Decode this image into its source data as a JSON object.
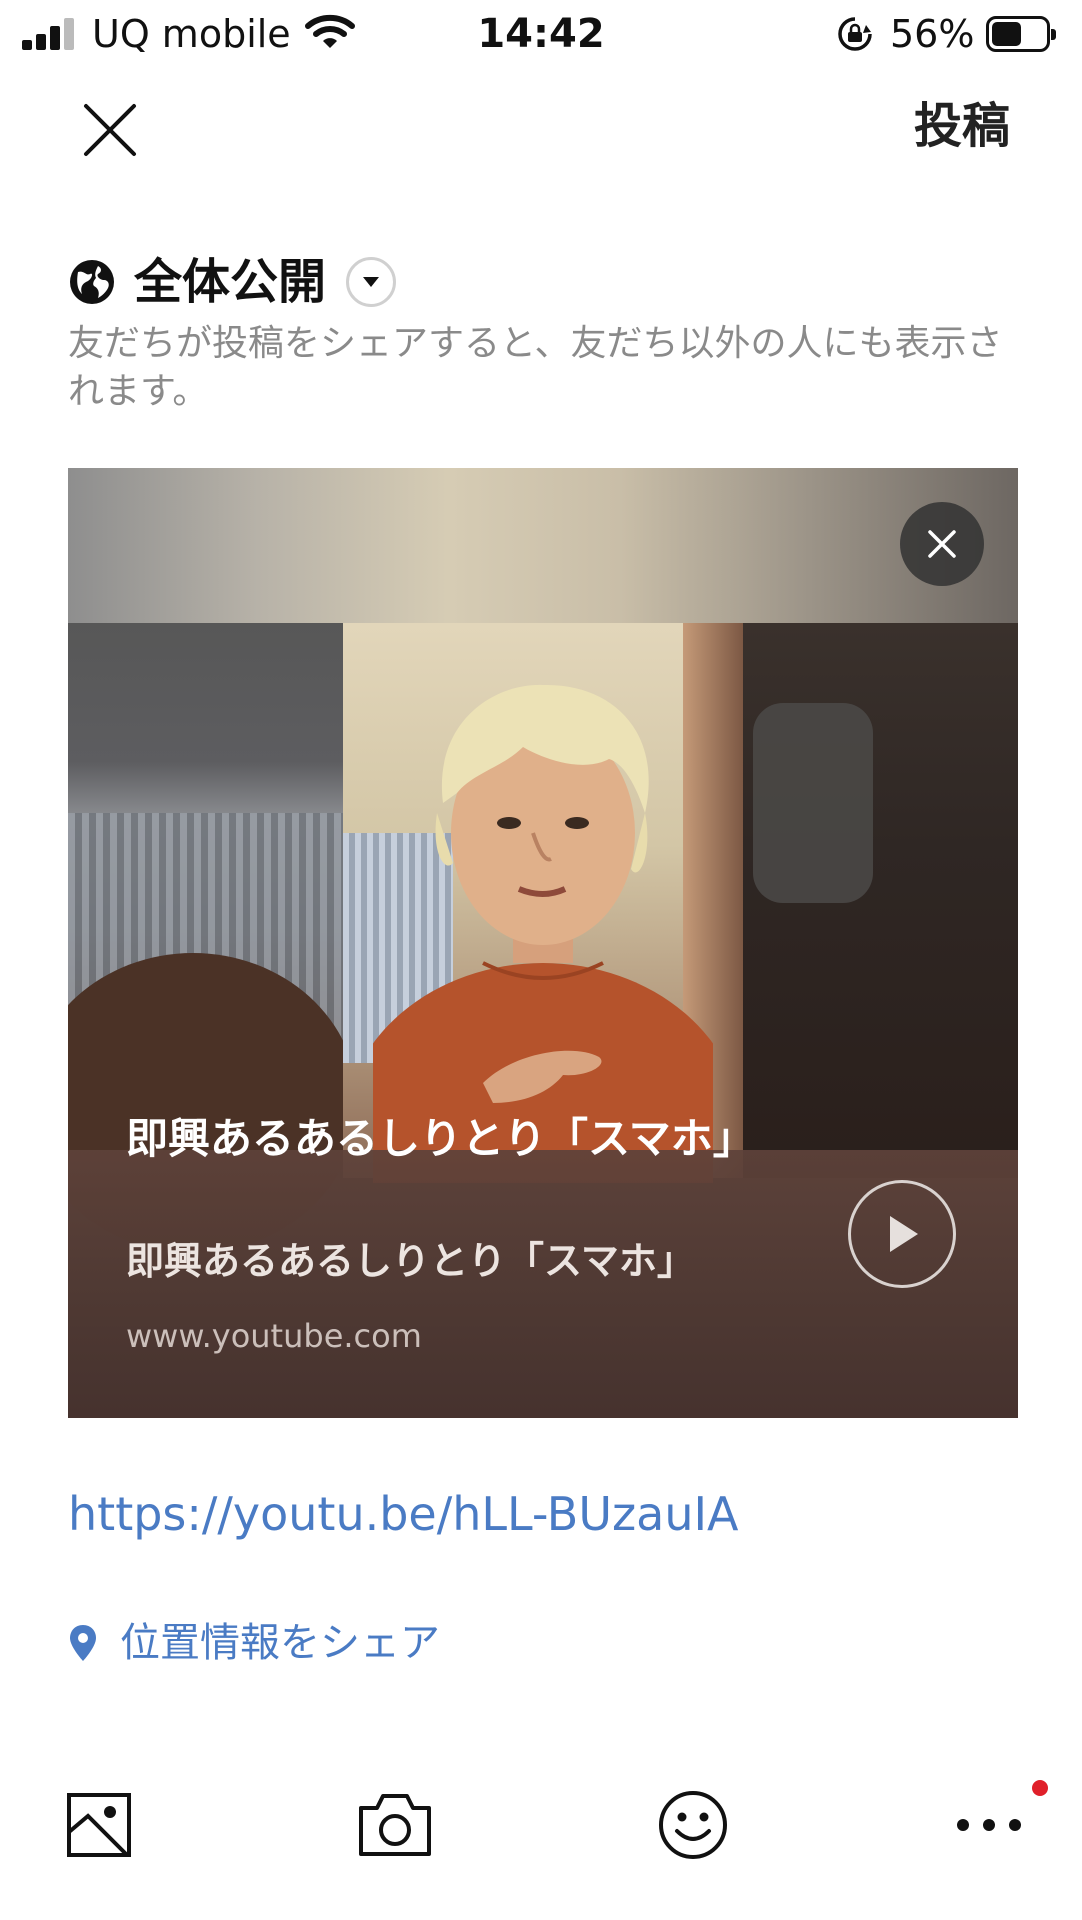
{
  "status_bar": {
    "carrier": "UQ mobile",
    "time": "14:42",
    "battery_percent": "56%",
    "battery_level": 0.56,
    "icons": [
      "signal-icon",
      "wifi-icon",
      "rotation-lock-icon",
      "battery-icon"
    ]
  },
  "header": {
    "close_icon": "close-icon",
    "post_label": "投稿"
  },
  "privacy": {
    "icon": "globe-icon",
    "label": "全体公開",
    "dropdown_icon": "triangle-down-icon",
    "note": "友だちが投稿をシェアすると、友だち以外の人にも表示されます。"
  },
  "link_card": {
    "title": "即興あるあるしりとり「スマホ」",
    "subtitle": "即興あるあるしりとり「スマホ」",
    "domain": "www.youtube.com",
    "close_icon": "close-icon",
    "play_icon": "play-icon"
  },
  "post_body": {
    "url": "https://youtu.be/hLL-BUzauIA"
  },
  "location": {
    "icon": "location-pin-icon",
    "label": "位置情報をシェア"
  },
  "toolbar": {
    "items": [
      "image-icon",
      "camera-icon",
      "smiley-icon",
      "more-icon"
    ],
    "notification_color": "#e0202a"
  },
  "colors": {
    "link": "#4a7bc4",
    "note": "#8a8a8a"
  }
}
